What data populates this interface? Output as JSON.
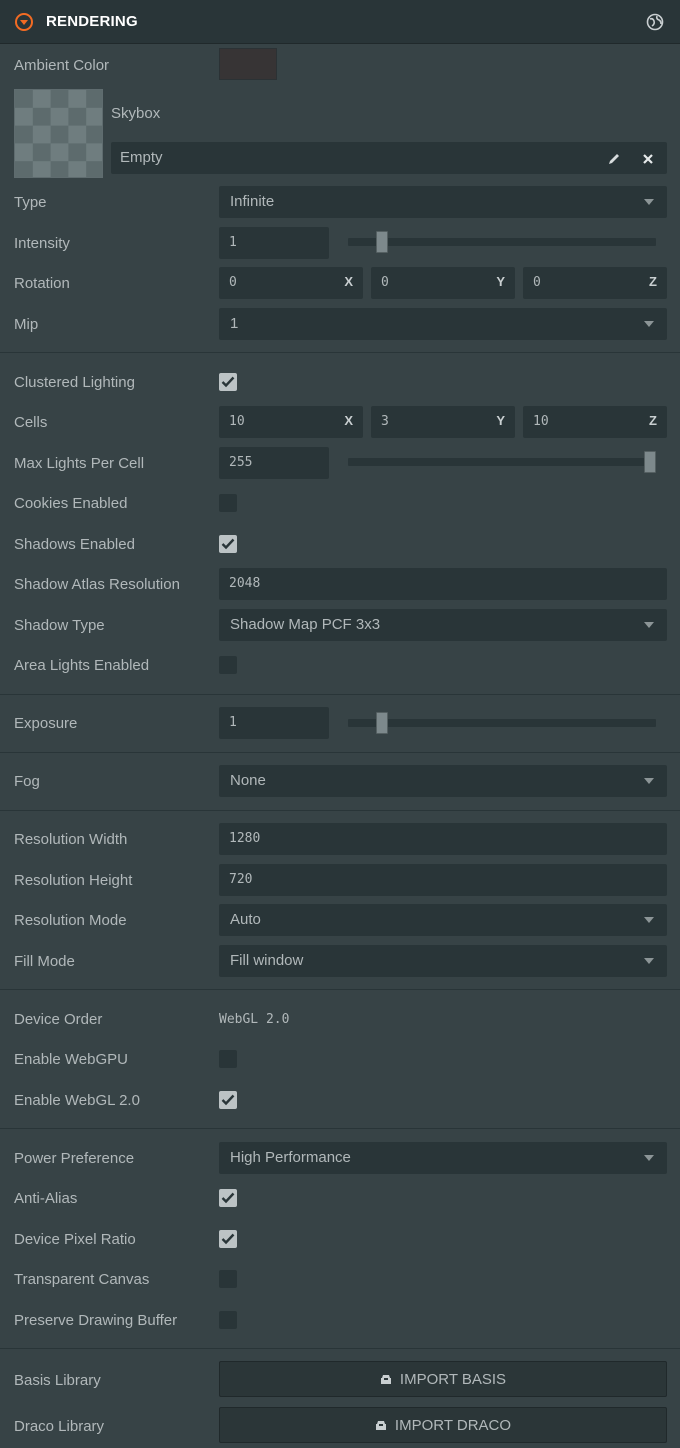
{
  "header": {
    "title": "RENDERING",
    "collapse_icon": "collapse-arrow-icon",
    "scope_icon": "globe-icon"
  },
  "ambient": {
    "label": "Ambient Color",
    "color": "#373435"
  },
  "skybox": {
    "label": "Skybox",
    "value": "Empty",
    "edit_icon": "pencil-icon",
    "clear_icon": "close-icon"
  },
  "type": {
    "label": "Type",
    "value": "Infinite"
  },
  "intensity": {
    "label": "Intensity",
    "value": "1",
    "slider_fraction": 0.1
  },
  "rotation": {
    "label": "Rotation",
    "x": "0",
    "y": "0",
    "z": "0",
    "x_label": "X",
    "y_label": "Y",
    "z_label": "Z"
  },
  "mip": {
    "label": "Mip",
    "value": "1"
  },
  "clustered": {
    "label": "Clustered Lighting",
    "checked": true
  },
  "cells": {
    "label": "Cells",
    "x": "10",
    "y": "3",
    "z": "10",
    "x_label": "X",
    "y_label": "Y",
    "z_label": "Z"
  },
  "max_lights": {
    "label": "Max Lights Per Cell",
    "value": "255",
    "slider_fraction": 1.0
  },
  "cookies": {
    "label": "Cookies Enabled",
    "checked": false
  },
  "shadows": {
    "label": "Shadows Enabled",
    "checked": true
  },
  "shadow_atlas": {
    "label": "Shadow Atlas Resolution",
    "value": "2048"
  },
  "shadow_type": {
    "label": "Shadow Type",
    "value": "Shadow Map PCF 3x3"
  },
  "area_lights": {
    "label": "Area Lights Enabled",
    "checked": false
  },
  "exposure": {
    "label": "Exposure",
    "value": "1",
    "slider_fraction": 0.1
  },
  "fog": {
    "label": "Fog",
    "value": "None"
  },
  "res_width": {
    "label": "Resolution Width",
    "value": "1280"
  },
  "res_height": {
    "label": "Resolution Height",
    "value": "720"
  },
  "res_mode": {
    "label": "Resolution Mode",
    "value": "Auto"
  },
  "fill_mode": {
    "label": "Fill Mode",
    "value": "Fill window"
  },
  "device_order": {
    "label": "Device Order",
    "value": "WebGL 2.0"
  },
  "webgpu": {
    "label": "Enable WebGPU",
    "checked": false
  },
  "webgl2": {
    "label": "Enable WebGL 2.0",
    "checked": true
  },
  "power": {
    "label": "Power Preference",
    "value": "High Performance"
  },
  "antialias": {
    "label": "Anti-Alias",
    "checked": true
  },
  "dpr": {
    "label": "Device Pixel Ratio",
    "checked": true
  },
  "transparent": {
    "label": "Transparent Canvas",
    "checked": false
  },
  "preserve": {
    "label": "Preserve Drawing Buffer",
    "checked": false
  },
  "basis": {
    "label": "Basis Library",
    "button": "IMPORT BASIS",
    "icon": "download-icon"
  },
  "draco": {
    "label": "Draco Library",
    "button": "IMPORT DRACO",
    "icon": "download-icon"
  }
}
